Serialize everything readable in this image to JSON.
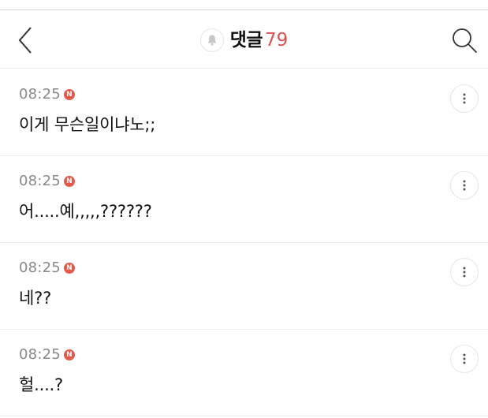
{
  "header": {
    "back_icon": "chevron-left-icon",
    "bell_icon": "bell-icon",
    "title": "댓글",
    "count": "79",
    "search_icon": "search-icon"
  },
  "colors": {
    "accent": "#d9534f",
    "badge": "#e15a4c",
    "timestamp": "#888888",
    "divider": "#ececec"
  },
  "comments": [
    {
      "time": "08:25",
      "badge": "N",
      "text": "이게 무슨일이냐노;;",
      "more_icon": "more-vertical-icon"
    },
    {
      "time": "08:25",
      "badge": "N",
      "text": "어.....예,,,,,??????",
      "more_icon": "more-vertical-icon"
    },
    {
      "time": "08:25",
      "badge": "N",
      "text": "네??",
      "more_icon": "more-vertical-icon"
    },
    {
      "time": "08:25",
      "badge": "N",
      "text": "헐....?",
      "more_icon": "more-vertical-icon"
    }
  ]
}
